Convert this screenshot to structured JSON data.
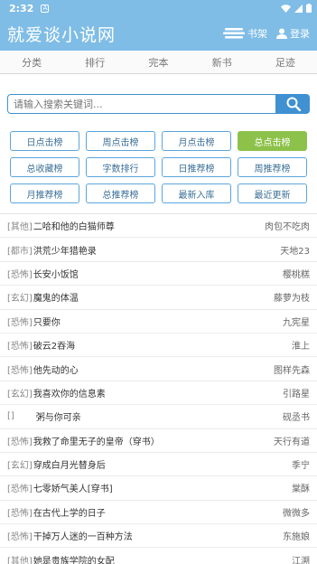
{
  "status": {
    "time": "2:32",
    "notif": "A"
  },
  "header": {
    "title": "就爱谈小说网",
    "bookshelf": "书架",
    "login": "登录"
  },
  "nav": [
    {
      "label": "分类"
    },
    {
      "label": "排行"
    },
    {
      "label": "完本"
    },
    {
      "label": "新书"
    },
    {
      "label": "足迹"
    }
  ],
  "search": {
    "placeholder": "请输入搜索关键词..."
  },
  "ranks": [
    {
      "label": "日点击榜"
    },
    {
      "label": "周点击榜"
    },
    {
      "label": "月点击榜"
    },
    {
      "label": "总点击榜"
    },
    {
      "label": "总收藏榜"
    },
    {
      "label": "字数排行"
    },
    {
      "label": "日推荐榜"
    },
    {
      "label": "周推荐榜"
    },
    {
      "label": "月推荐榜"
    },
    {
      "label": "总推荐榜"
    },
    {
      "label": "最新入库"
    },
    {
      "label": "最近更新"
    }
  ],
  "books": [
    {
      "cat": "[其他]",
      "title": "二哈和他的白猫师尊",
      "author": "肉包不吃肉"
    },
    {
      "cat": "[都市]",
      "title": "洪荒少年猎艳录",
      "author": "天地23"
    },
    {
      "cat": "[恐怖]",
      "title": "长安小饭馆",
      "author": "樱桃糕"
    },
    {
      "cat": "[玄幻]",
      "title": "魔鬼的体温",
      "author": "藤萝为枝"
    },
    {
      "cat": "[恐怖]",
      "title": "只要你",
      "author": "九宪星"
    },
    {
      "cat": "[恐怖]",
      "title": "破云2吞海",
      "author": "淮上"
    },
    {
      "cat": "[恐怖]",
      "title": "他先动的心",
      "author": "图样先森"
    },
    {
      "cat": "[玄幻]",
      "title": "我喜欢你的信息素",
      "author": "引路星"
    },
    {
      "cat": "[]",
      "title": "粥与你可亲",
      "author": "砚丞书"
    },
    {
      "cat": "[恐怖]",
      "title": "我救了命里无子的皇帝（穿书）",
      "author": "天行有道"
    },
    {
      "cat": "[玄幻]",
      "title": "穿成白月光替身后",
      "author": "季宁"
    },
    {
      "cat": "[恐怖]",
      "title": "七零娇气美人[穿书]",
      "author": "棠酥"
    },
    {
      "cat": "[恐怖]",
      "title": "在古代上学的日子",
      "author": "微微多"
    },
    {
      "cat": "[恐怖]",
      "title": "干掉万人迷的一百种方法",
      "author": "东施娘"
    },
    {
      "cat": "[其他]",
      "title": "她是贵族学院的女配",
      "author": "江溯"
    }
  ]
}
